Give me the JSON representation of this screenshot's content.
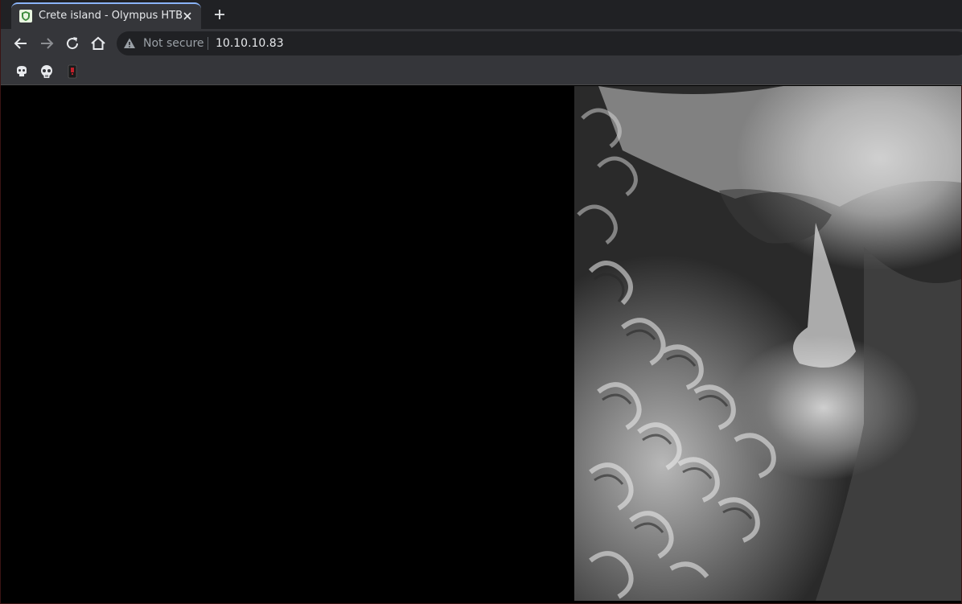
{
  "tab": {
    "title": "Crete island - Olympus HTB",
    "favicon": "green-shield-favicon"
  },
  "toolbar": {
    "back_icon": "back-arrow-icon",
    "forward_icon": "forward-arrow-icon",
    "reload_icon": "reload-icon",
    "home_icon": "home-icon"
  },
  "omnibox": {
    "security_label": "Not secure",
    "security_icon": "warning-triangle-icon",
    "url": "10.10.10.83"
  },
  "bookmarks": [
    {
      "icon": "skull-bookmark-icon"
    },
    {
      "icon": "skull-round-bookmark-icon"
    },
    {
      "icon": "red-phone-bookmark-icon"
    }
  ],
  "colors": {
    "tabstrip": "#202124",
    "toolbar": "#35363a",
    "accent": "#8ab4f8",
    "page_background": "#000000"
  },
  "content": {
    "image": "marble-bearded-statue-head"
  }
}
